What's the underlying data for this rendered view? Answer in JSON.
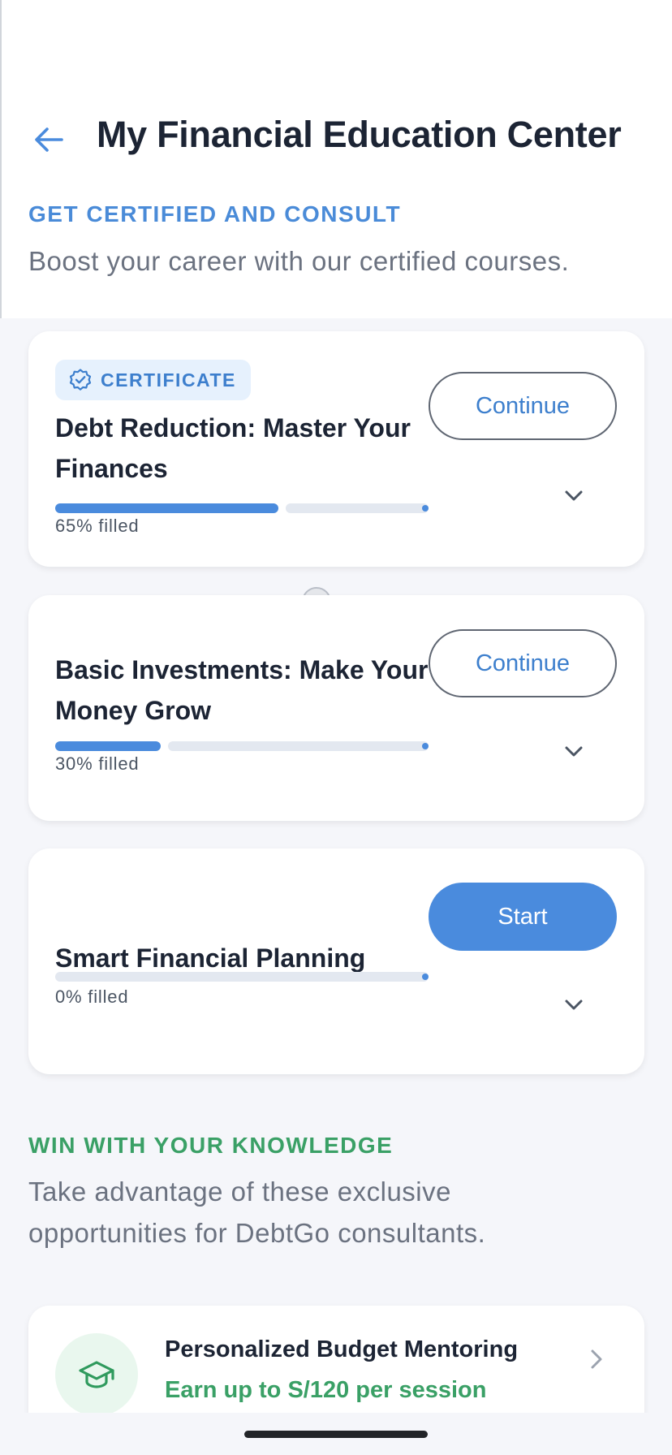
{
  "header": {
    "title": "My Financial Education Center",
    "section_label": "GET CERTIFIED AND CONSULT",
    "section_subtitle": "Boost your career with our certified courses."
  },
  "courses": [
    {
      "badge": "CERTIFICATE",
      "title": "Debt Reduction: Master Your Finances",
      "progress": 0.65,
      "progress_label": "65% filled",
      "button_label": "Continue"
    },
    {
      "title": "Basic Investments: Make Your Money Grow",
      "progress": 0.3,
      "progress_label": "30% filled",
      "button_label": "Continue"
    },
    {
      "title": "Smart Financial Planning",
      "progress": 0,
      "progress_label": "0% filled",
      "button_label": "Start"
    }
  ],
  "knowledge": {
    "section_label": "WIN WITH YOUR KNOWLEDGE",
    "section_subtitle": "Take advantage of these exclusive opportunities for DebtGo consultants.",
    "opportunity": {
      "title": "Personalized Budget Mentoring",
      "earn_label": "Earn up to S/120 per session",
      "icon": "graduation-cap-icon"
    }
  },
  "colors": {
    "accent_blue": "#4a8bdd",
    "accent_green": "#3aa066",
    "track_gray": "#e3e8f0"
  }
}
